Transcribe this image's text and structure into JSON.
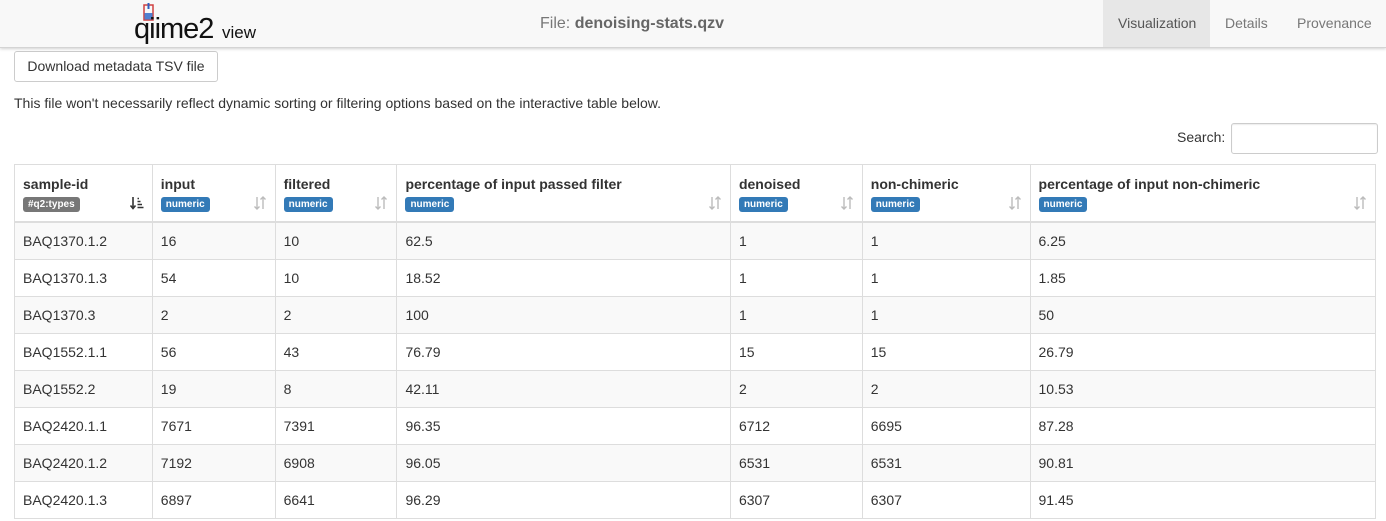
{
  "navbar": {
    "brand_main": "qiime2",
    "brand_sub": "view",
    "file_label": "File:",
    "file_name": "denoising-stats.qzv",
    "tabs": [
      {
        "label": "Visualization",
        "active": true
      },
      {
        "label": "Details",
        "active": false
      },
      {
        "label": "Provenance",
        "active": false
      }
    ]
  },
  "download_button": "Download metadata TSV file",
  "note": "This file won't necessarily reflect dynamic sorting or filtering options based on the interactive table below.",
  "search": {
    "label": "Search:",
    "value": ""
  },
  "table": {
    "columns": [
      {
        "name": "sample-id",
        "badge": "#q2:types"
      },
      {
        "name": "input",
        "badge": "numeric"
      },
      {
        "name": "filtered",
        "badge": "numeric"
      },
      {
        "name": "percentage of input passed filter",
        "badge": "numeric"
      },
      {
        "name": "denoised",
        "badge": "numeric"
      },
      {
        "name": "non-chimeric",
        "badge": "numeric"
      },
      {
        "name": "percentage of input non-chimeric",
        "badge": "numeric"
      }
    ],
    "rows": [
      [
        "BAQ1370.1.2",
        "16",
        "10",
        "62.5",
        "1",
        "1",
        "6.25"
      ],
      [
        "BAQ1370.1.3",
        "54",
        "10",
        "18.52",
        "1",
        "1",
        "1.85"
      ],
      [
        "BAQ1370.3",
        "2",
        "2",
        "100",
        "1",
        "1",
        "50"
      ],
      [
        "BAQ1552.1.1",
        "56",
        "43",
        "76.79",
        "15",
        "15",
        "26.79"
      ],
      [
        "BAQ1552.2",
        "19",
        "8",
        "42.11",
        "2",
        "2",
        "10.53"
      ],
      [
        "BAQ2420.1.1",
        "7671",
        "7391",
        "96.35",
        "6712",
        "6695",
        "87.28"
      ],
      [
        "BAQ2420.1.2",
        "7192",
        "6908",
        "96.05",
        "6531",
        "6531",
        "90.81"
      ],
      [
        "BAQ2420.1.3",
        "6897",
        "6641",
        "96.29",
        "6307",
        "6307",
        "91.45"
      ]
    ]
  },
  "colors": {
    "navbar_bg": "#f8f8f8",
    "active_tab_bg": "#e7e7e7",
    "badge_types": "#777777",
    "badge_numeric": "#337ab7",
    "striped_row": "#f9f9f9"
  }
}
